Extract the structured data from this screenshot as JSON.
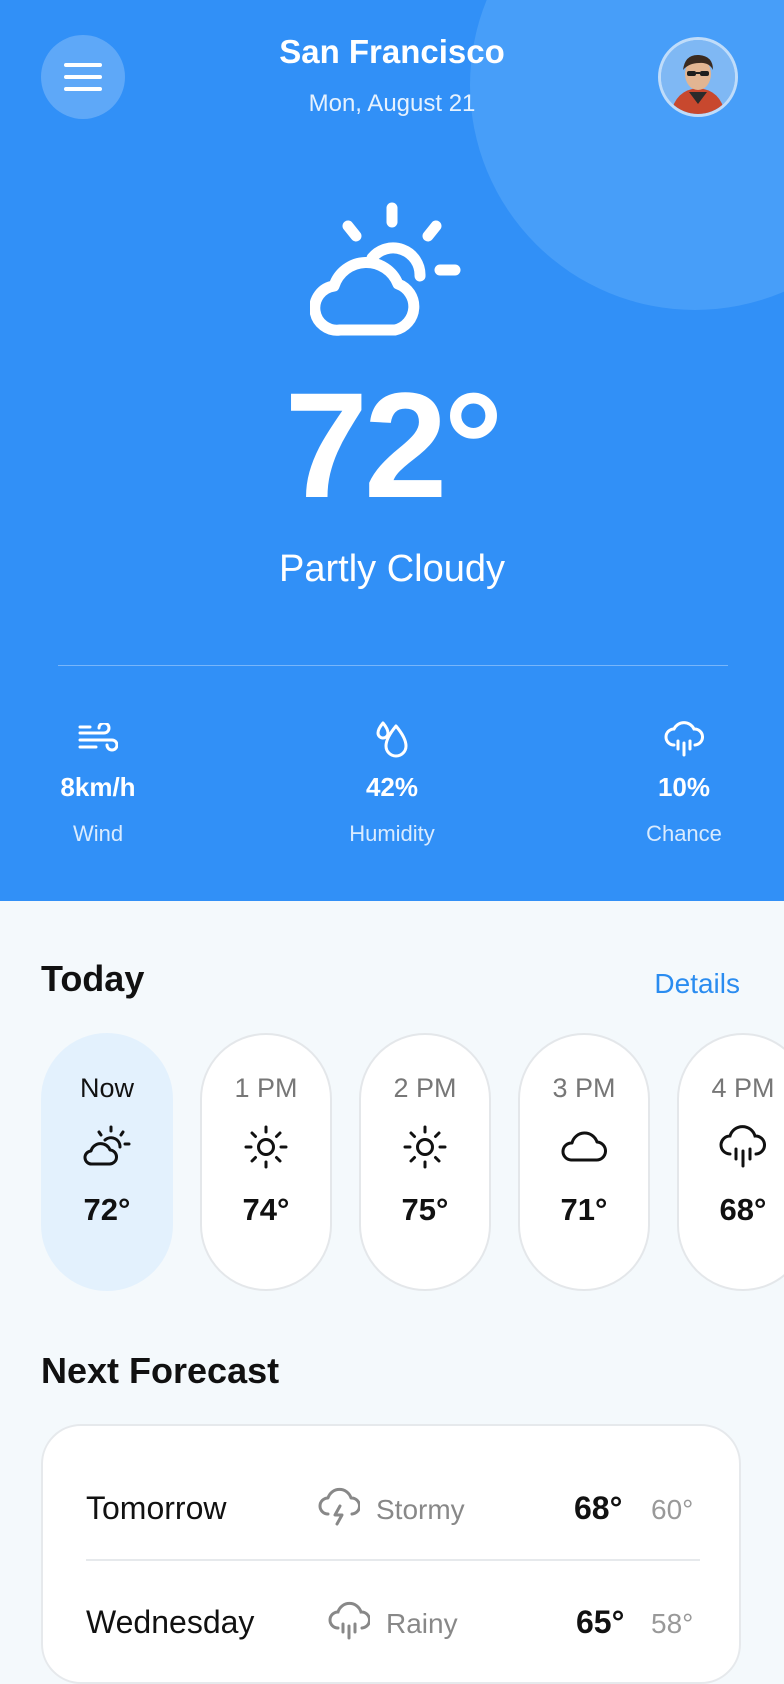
{
  "header": {
    "city": "San Francisco",
    "date": "Mon, August 21"
  },
  "current": {
    "temp": "72°",
    "condition": "Partly Cloudy",
    "icon": "partly-cloudy-icon"
  },
  "stats": [
    {
      "icon": "wind-icon",
      "value": "8km/h",
      "label": "Wind"
    },
    {
      "icon": "humidity-icon",
      "value": "42%",
      "label": "Humidity"
    },
    {
      "icon": "rain-chance-icon",
      "value": "10%",
      "label": "Chance"
    }
  ],
  "today": {
    "title": "Today",
    "details_label": "Details",
    "hours": [
      {
        "time": "Now",
        "icon": "partly-cloudy-icon",
        "temp": "72°",
        "active": true
      },
      {
        "time": "1 PM",
        "icon": "sun-icon",
        "temp": "74°"
      },
      {
        "time": "2 PM",
        "icon": "sun-icon",
        "temp": "75°"
      },
      {
        "time": "3 PM",
        "icon": "cloud-icon",
        "temp": "71°"
      },
      {
        "time": "4 PM",
        "icon": "rain-icon",
        "temp": "68°"
      }
    ]
  },
  "next": {
    "title": "Next Forecast",
    "days": [
      {
        "day": "Tomorrow",
        "icon": "storm-icon",
        "condition": "Stormy",
        "high": "68°",
        "low": "60°"
      },
      {
        "day": "Wednesday",
        "icon": "rain-icon",
        "condition": "Rainy",
        "high": "65°",
        "low": "58°"
      }
    ]
  },
  "colors": {
    "primary": "#3190f7",
    "accent": "#2a8cf0",
    "active_card": "#e3f1fd"
  }
}
